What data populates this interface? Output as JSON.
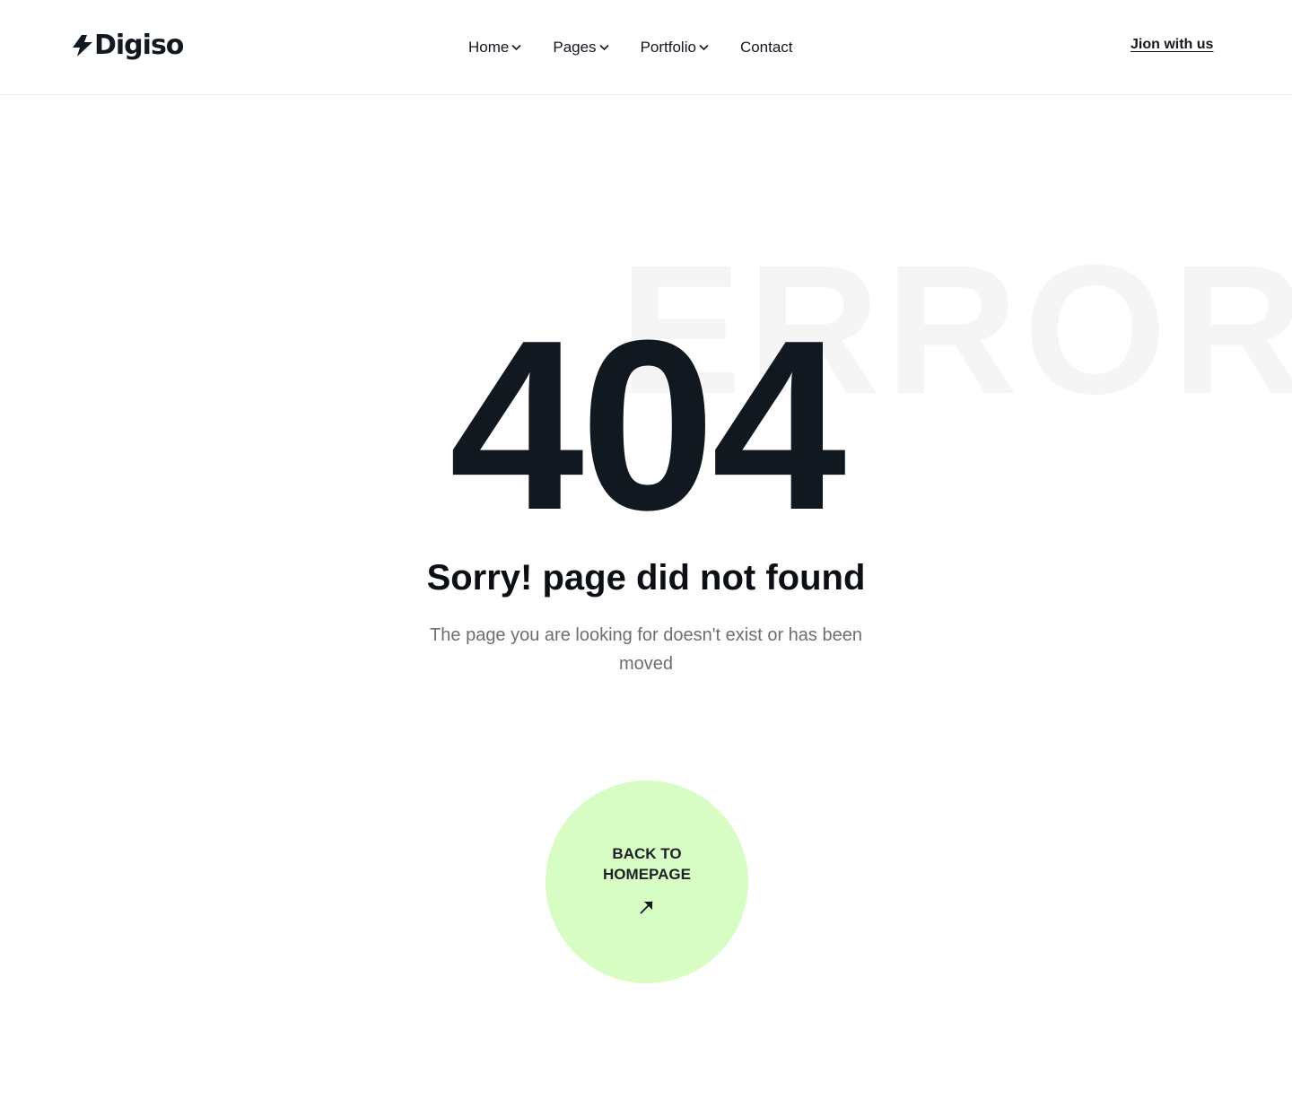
{
  "brand": {
    "name": "Digiso",
    "icon": "bolt-logo-icon"
  },
  "nav": {
    "items": [
      {
        "label": "Home",
        "has_dropdown": true
      },
      {
        "label": "Pages",
        "has_dropdown": true
      },
      {
        "label": "Portfolio",
        "has_dropdown": true
      },
      {
        "label": "Contact",
        "has_dropdown": false
      }
    ],
    "join_label": "Jion with us"
  },
  "error": {
    "watermark": "ERROR",
    "code": "404",
    "title": "Sorry! page did not found",
    "description": "The page you are looking for doesn't exist or has been moved"
  },
  "cta": {
    "label": "BACK TO HOMEPAGE",
    "icon": "arrow-up-right-icon"
  },
  "colors": {
    "text": "#121820",
    "muted": "#6b6e73",
    "cta_bg": "#d7fdc5",
    "watermark": "#f5f5f5",
    "border": "#ececec"
  }
}
